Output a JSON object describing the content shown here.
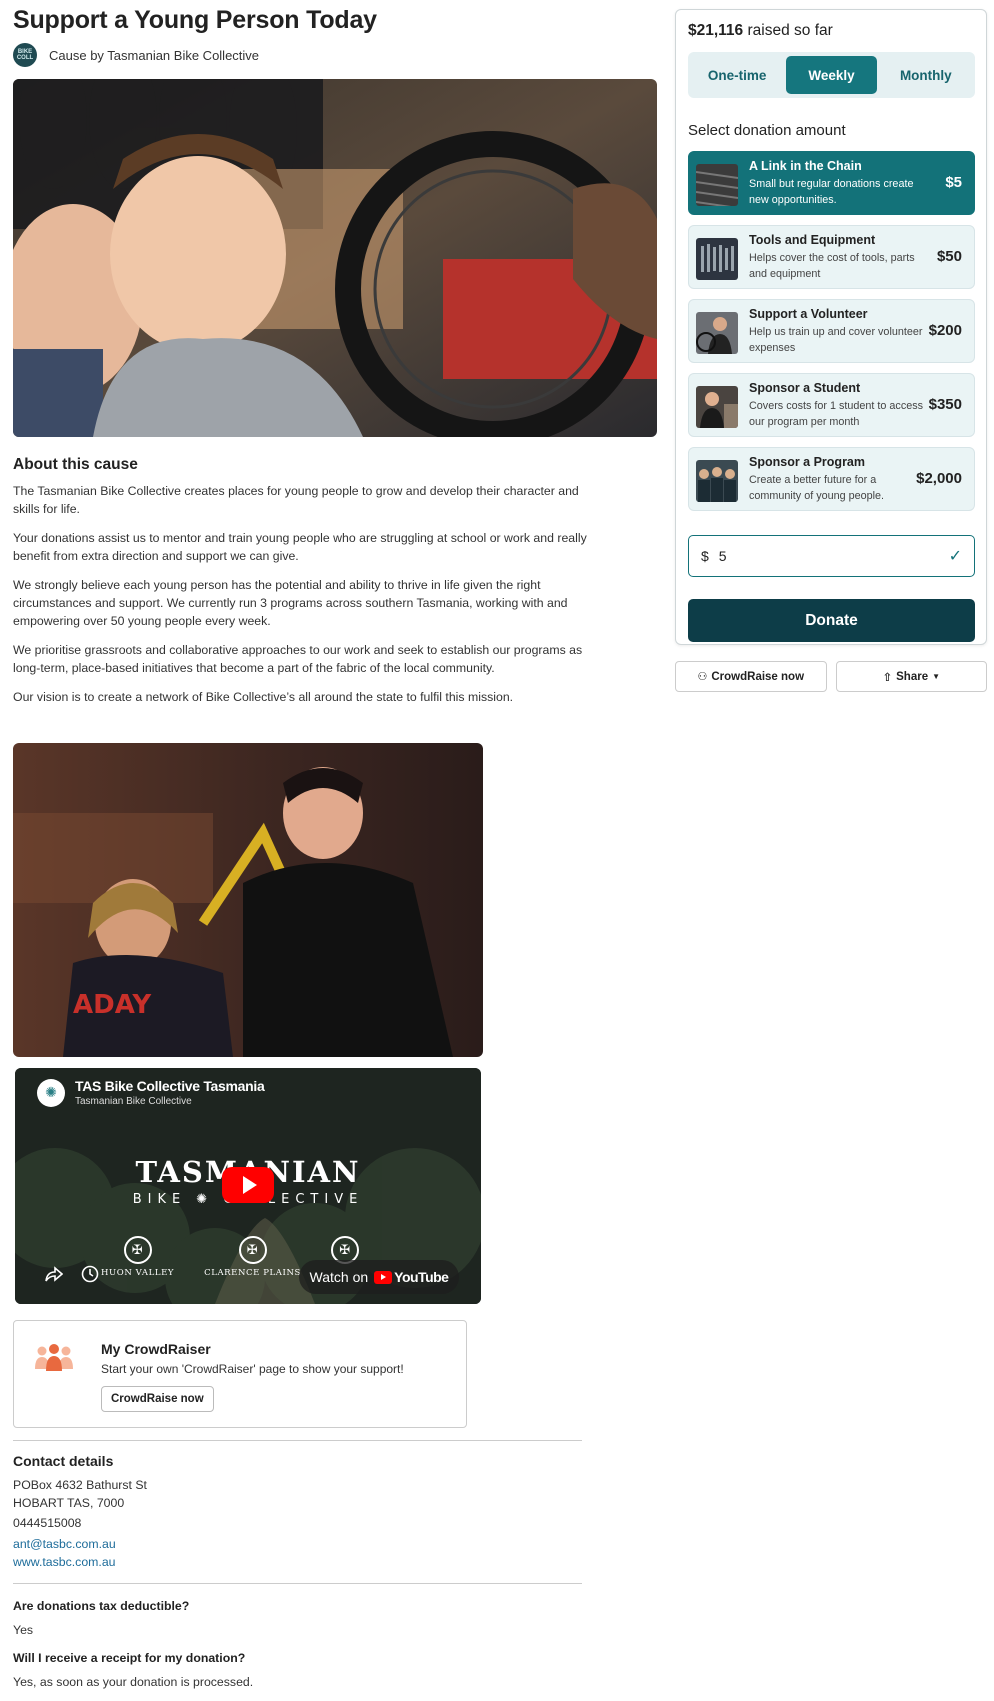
{
  "header": {
    "title": "Support a Young Person Today",
    "byline": "Cause by Tasmanian Bike Collective",
    "org_logo_text": "BIKE COLL"
  },
  "about": {
    "title": "About this cause",
    "paragraphs": [
      "The Tasmanian Bike Collective creates places for young people to grow and develop their character and skills for life.",
      "Your donations assist us to mentor and train young people who are struggling at school or work and really benefit from extra direction and support we can give.",
      "We strongly believe each young person has the potential and ability to thrive in life given the right circumstances and support. We currently run 3 programs across southern Tasmania, working with and empowering over 50 young people every week.",
      "We prioritise grassroots and collaborative approaches to our work and seek to establish our programs as long-term, place-based initiatives that become a part of the fabric of the local community.",
      "Our vision is to create a network of Bike Collective’s all around the state to fulfil this mission."
    ]
  },
  "video": {
    "title": "TAS Bike Collective Tasmania",
    "channel": "Tasmanian Bike Collective",
    "brand_line1": "TASMANIAN",
    "brand_line2": "BIKE ✺ COLLECTIVE",
    "locations": [
      "HUON VALLEY",
      "CLARENCE PLAINS",
      ""
    ],
    "watch_on": "Watch on",
    "youtube": "YouTube"
  },
  "crowdraiser": {
    "title": "My CrowdRaiser",
    "description": "Start your own 'CrowdRaiser' page to show your support!",
    "button": "CrowdRaise now"
  },
  "contact": {
    "title": "Contact details",
    "address1": "POBox 4632 Bathurst St",
    "address2": "HOBART TAS, 7000",
    "phone": "0444515008",
    "email": "ant@tasbc.com.au",
    "website": "www.tasbc.com.au"
  },
  "faq": [
    {
      "q": "Are donations tax deductible?",
      "a": "Yes"
    },
    {
      "q": "Will I receive a receipt for my donation?",
      "a": "Yes, as soon as your donation is processed."
    }
  ],
  "donation": {
    "raised_amount": "$21,116",
    "raised_suffix": " raised so far",
    "frequencies": [
      "One-time",
      "Weekly",
      "Monthly"
    ],
    "active_frequency": "Weekly",
    "select_label": "Select donation amount",
    "tiers": [
      {
        "name": "A Link in the Chain",
        "desc": "Small but regular donations create new opportunities.",
        "amount": "$5",
        "active": true
      },
      {
        "name": "Tools and Equipment",
        "desc": "Helps cover the cost of tools, parts and equipment",
        "amount": "$50",
        "active": false
      },
      {
        "name": "Support a Volunteer",
        "desc": "Help us train up and cover volunteer expenses",
        "amount": "$200",
        "active": false
      },
      {
        "name": "Sponsor a Student",
        "desc": "Covers costs for 1 student to access our program per month",
        "amount": "$350",
        "active": false
      },
      {
        "name": "Sponsor a Program",
        "desc": "Create a better future for a community of young people.",
        "amount": "$2,000",
        "active": false
      }
    ],
    "currency_symbol": "$",
    "amount_value": "5",
    "donate_label": "Donate"
  },
  "actions": {
    "crowdraise_label": "CrowdRaise now",
    "share_label": "Share"
  },
  "colors": {
    "accent": "#137279",
    "donate": "#0d3d48",
    "link": "#1d6c9a"
  }
}
